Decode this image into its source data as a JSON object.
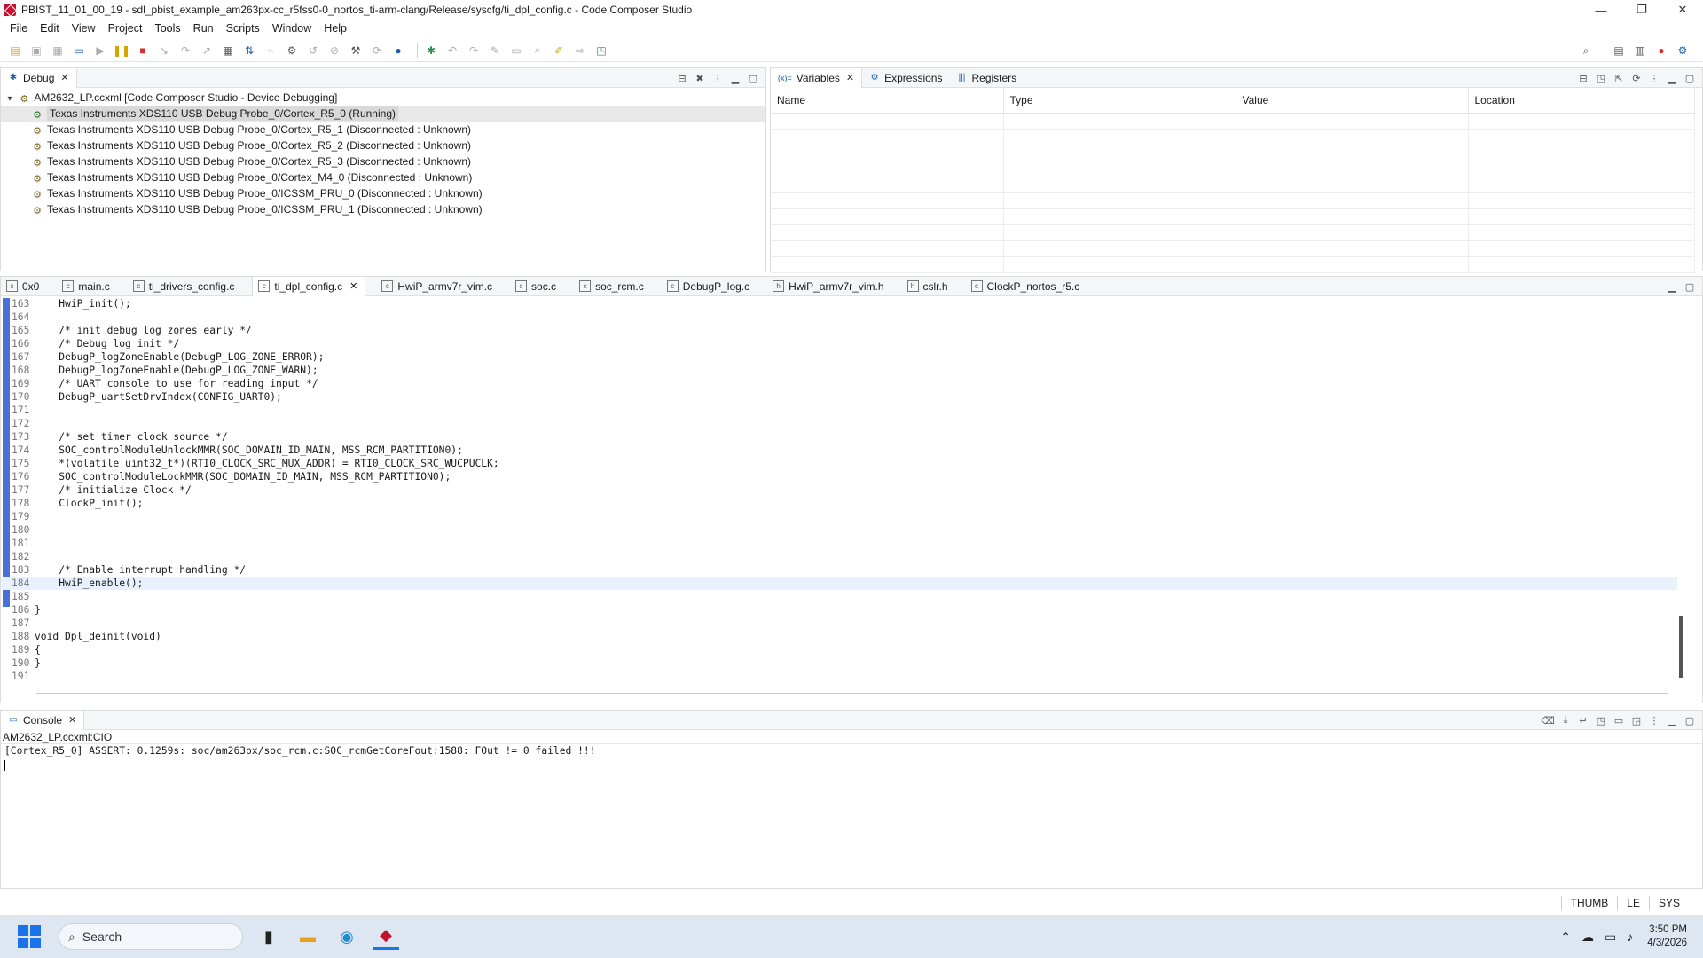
{
  "window": {
    "title": "PBIST_11_01_00_19 - sdl_pbist_example_am263px-cc_r5fss0-0_nortos_ti-arm-clang/Release/syscfg/ti_dpl_config.c - Code Composer Studio",
    "minimize": "—",
    "maximize": "❐",
    "close": "✕"
  },
  "menu": [
    "File",
    "Edit",
    "View",
    "Project",
    "Tools",
    "Run",
    "Scripts",
    "Window",
    "Help"
  ],
  "debug_panel": {
    "tab": "Debug",
    "root": "AM2632_LP.ccxml [Code Composer Studio - Device Debugging]",
    "items": [
      "Texas Instruments XDS110 USB Debug Probe_0/Cortex_R5_0 (Running)",
      "Texas Instruments XDS110 USB Debug Probe_0/Cortex_R5_1 (Disconnected : Unknown)",
      "Texas Instruments XDS110 USB Debug Probe_0/Cortex_R5_2 (Disconnected : Unknown)",
      "Texas Instruments XDS110 USB Debug Probe_0/Cortex_R5_3 (Disconnected : Unknown)",
      "Texas Instruments XDS110 USB Debug Probe_0/Cortex_M4_0 (Disconnected : Unknown)",
      "Texas Instruments XDS110 USB Debug Probe_0/ICSSM_PRU_0 (Disconnected : Unknown)",
      "Texas Instruments XDS110 USB Debug Probe_0/ICSSM_PRU_1 (Disconnected : Unknown)"
    ]
  },
  "variables_panel": {
    "tabs": [
      "Variables",
      "Expressions",
      "Registers"
    ],
    "tab_icons": [
      "(x)=",
      "⚙",
      "|||"
    ],
    "columns": [
      "Name",
      "Type",
      "Value",
      "Location"
    ]
  },
  "editor": {
    "tabs": [
      "0x0",
      "main.c",
      "ti_drivers_config.c",
      "ti_dpl_config.c",
      "HwiP_armv7r_vim.c",
      "soc.c",
      "soc_rcm.c",
      "DebugP_log.c",
      "HwiP_armv7r_vim.h",
      "cslr.h",
      "ClockP_nortos_r5.c"
    ],
    "lines": [
      {
        "n": "163",
        "t": "    HwiP_init();"
      },
      {
        "n": "164",
        "t": ""
      },
      {
        "n": "165",
        "t": "    /* init debug log zones early */"
      },
      {
        "n": "166",
        "t": "    /* Debug log init */"
      },
      {
        "n": "167",
        "t": "    DebugP_logZoneEnable(DebugP_LOG_ZONE_ERROR);"
      },
      {
        "n": "168",
        "t": "    DebugP_logZoneEnable(DebugP_LOG_ZONE_WARN);"
      },
      {
        "n": "169",
        "t": "    /* UART console to use for reading input */"
      },
      {
        "n": "170",
        "t": "    DebugP_uartSetDrvIndex(CONFIG_UART0);"
      },
      {
        "n": "171",
        "t": ""
      },
      {
        "n": "172",
        "t": ""
      },
      {
        "n": "173",
        "t": "    /* set timer clock source */"
      },
      {
        "n": "174",
        "t": "    SOC_controlModuleUnlockMMR(SOC_DOMAIN_ID_MAIN, MSS_RCM_PARTITION0);"
      },
      {
        "n": "175",
        "t": "    *(volatile uint32_t*)(RTI0_CLOCK_SRC_MUX_ADDR) = RTI0_CLOCK_SRC_WUCPUCLK;"
      },
      {
        "n": "176",
        "t": "    SOC_controlModuleLockMMR(SOC_DOMAIN_ID_MAIN, MSS_RCM_PARTITION0);"
      },
      {
        "n": "177",
        "t": "    /* initialize Clock */"
      },
      {
        "n": "178",
        "t": "    ClockP_init();"
      },
      {
        "n": "179",
        "t": ""
      },
      {
        "n": "180",
        "t": ""
      },
      {
        "n": "181",
        "t": ""
      },
      {
        "n": "182",
        "t": ""
      },
      {
        "n": "183",
        "t": "    /* Enable interrupt handling */"
      },
      {
        "n": "184",
        "t": "    HwiP_enable();"
      },
      {
        "n": "185",
        "t": ""
      },
      {
        "n": "186",
        "t": "}"
      },
      {
        "n": "187",
        "t": ""
      },
      {
        "n": "188",
        "t": "void Dpl_deinit(void)"
      },
      {
        "n": "189",
        "t": "{"
      },
      {
        "n": "190",
        "t": "}"
      },
      {
        "n": "191",
        "t": ""
      }
    ]
  },
  "console": {
    "tab": "Console",
    "source": "AM2632_LP.ccxml:CIO",
    "output": "[Cortex_R5_0] ASSERT: 0.1259s: soc/am263px/soc_rcm.c:SOC_rcmGetCoreFout:1588: FOut != 0 failed !!!"
  },
  "statusbar": [
    "THUMB",
    "LE",
    "SYS"
  ],
  "taskbar": {
    "search_placeholder": "Search",
    "time": "3:50 PM",
    "date": "4/3/2026"
  },
  "colors": {
    "accent": "#1a73e8",
    "ccs_red": "#c8102e",
    "taskbar_bg": "#dde6f1"
  }
}
